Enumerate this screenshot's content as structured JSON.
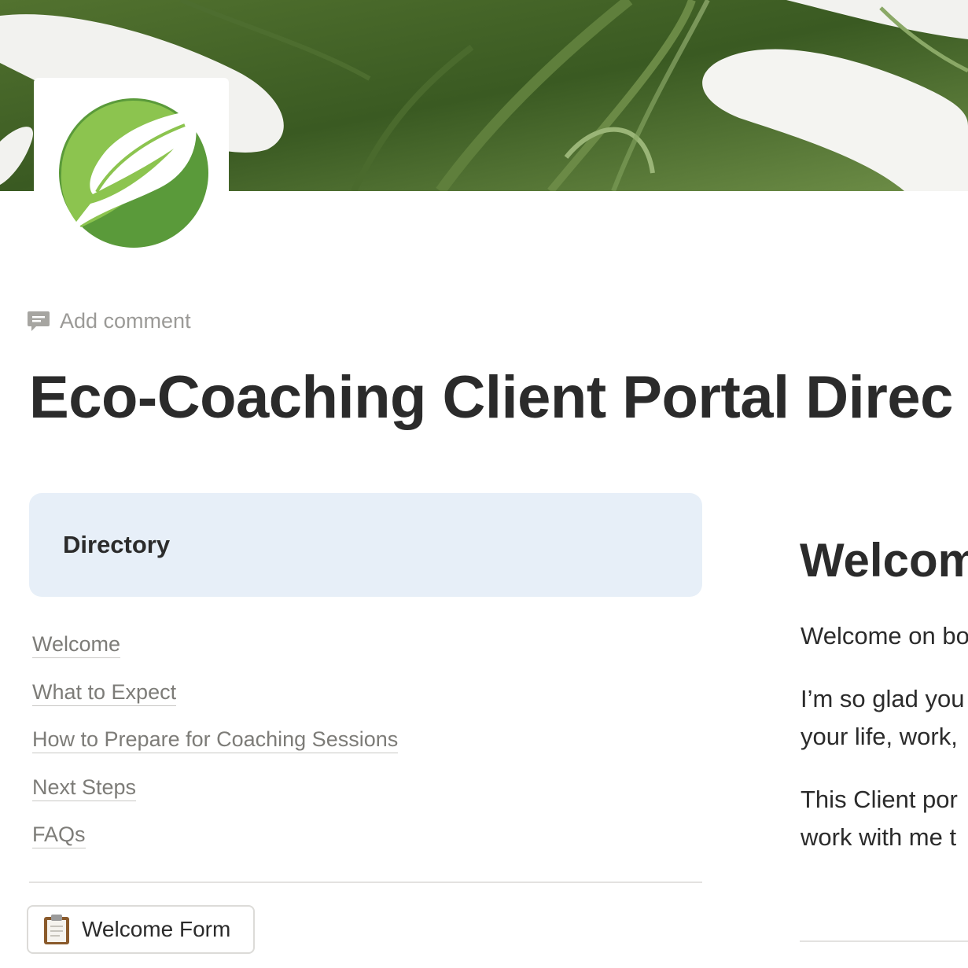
{
  "cover": {
    "image": "monstera-leaf-banner"
  },
  "page_icon": {
    "icon": "green-leaf-logo"
  },
  "comment": {
    "label": "Add comment",
    "icon": "comment-icon"
  },
  "title": "Eco-Coaching Client Portal Direc",
  "directory": {
    "heading": "Directory",
    "links": [
      "Welcome",
      "What to Expect",
      "How to Prepare for Coaching Sessions",
      "Next Steps",
      "FAQs"
    ]
  },
  "form_button": {
    "label": "Welcome Form",
    "icon": "clipboard-icon"
  },
  "welcome_section": {
    "heading": "Welcom",
    "paragraphs": [
      "Welcome on bo",
      "I’m so glad you",
      "your life, work,",
      "This Client por",
      "work with me t"
    ]
  },
  "colors": {
    "directory_bg": "#e7eff8",
    "link_text": "#7d7c78",
    "title_text": "#2b2b2b",
    "muted_text": "#9b9a97"
  }
}
